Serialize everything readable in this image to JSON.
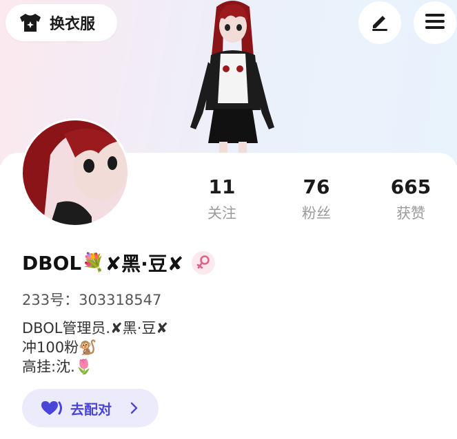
{
  "header": {
    "dress_up_label": "换衣服",
    "dress_up_icon": "tshirt-sparkle-icon",
    "edit_icon": "pen-icon",
    "menu_icon": "hamburger-menu-icon"
  },
  "stats": [
    {
      "value": "11",
      "label": "关注"
    },
    {
      "value": "76",
      "label": "粉丝"
    },
    {
      "value": "665",
      "label": "获赞"
    }
  ],
  "profile": {
    "name_prefix": "DBOL",
    "name_flowers": "💐",
    "name_mid": "✘黑·豆✘",
    "gender_icon": "female-icon",
    "id_line": "233号：303318547",
    "bio_lines": [
      "DBOL管理员.✘黑·豆✘",
      "冲100粉🐒",
      "高挂:沈.🌷"
    ]
  },
  "match_button": {
    "label": "去配对",
    "icon": "heart-icon",
    "arrow_icon": "chevron-right-icon"
  },
  "colors": {
    "accent": "#4a44d8",
    "match_bg": "#ecebfc",
    "stat_label": "#9a9a9a",
    "gender_badge_bg": "#fde8ee",
    "gender_symbol": "#e0608a"
  }
}
